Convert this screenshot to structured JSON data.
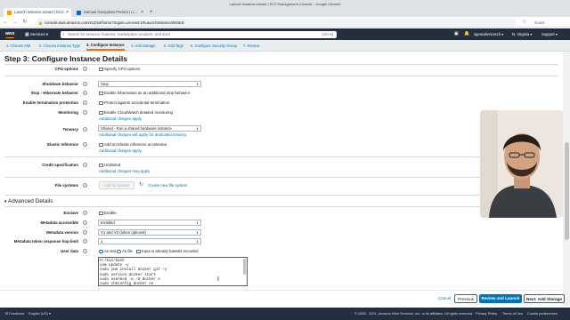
{
  "browser": {
    "window_title": "Launch instance wizard | EC2 Management Console - Google Chrome",
    "tabs": [
      {
        "label": "Launch instance wizard | EC2..."
      },
      {
        "label": "Samuel Gonçalves Pereira | Li..."
      }
    ],
    "new_tab": "+",
    "url": "console.aws.amazon.com/ec2/v2/home?region=us-east-1#LaunchInstanceWizard:",
    "profile": "Guest"
  },
  "aws_header": {
    "logo": "aws",
    "services_label": "Services",
    "search_placeholder": "Search for services, features, marketplace products, and docs",
    "search_shortcut": "[Alt+S]",
    "account": "sgoncalves.tech",
    "region": "N. Virginia",
    "support": "Support"
  },
  "wizard_steps": [
    {
      "label": "1. Choose AMI"
    },
    {
      "label": "2. Choose Instance Type"
    },
    {
      "label": "3. Configure Instance"
    },
    {
      "label": "4. Add Storage"
    },
    {
      "label": "5. Add Tags"
    },
    {
      "label": "6. Configure Security Group"
    },
    {
      "label": "7. Review"
    }
  ],
  "page_title": "Step 3: Configure Instance Details",
  "fields": {
    "cpu_options": {
      "label": "CPU options",
      "checkbox": "Specify CPU options"
    },
    "shutdown": {
      "label": "Shutdown behavior",
      "value": "Stop"
    },
    "hibernate": {
      "label": "Stop - Hibernate behavior",
      "checkbox": "Enable hibernation as an additional stop behavior"
    },
    "termination": {
      "label": "Enable termination protection",
      "checkbox": "Protect against accidental termination"
    },
    "monitoring": {
      "label": "Monitoring",
      "checkbox": "Enable CloudWatch detailed monitoring",
      "link": "Additional charges apply."
    },
    "tenancy": {
      "label": "Tenancy",
      "value": "Shared - Run a shared hardware instance",
      "link": "Additional charges will apply for dedicated tenancy."
    },
    "elastic_inference": {
      "label": "Elastic Inference",
      "checkbox": "Add an Elastic Inference accelerator",
      "link": "Additional charges apply."
    },
    "credit_spec": {
      "label": "Credit specification",
      "checkbox": "Unlimited",
      "link": "Additional charges may apply"
    },
    "file_systems": {
      "label": "File systems",
      "add_button": "Add file system",
      "create_link": "Create new file system"
    }
  },
  "advanced": {
    "section_title": "Advanced Details",
    "enclave": {
      "label": "Enclave",
      "checkbox": "Enable"
    },
    "metadata_accessible": {
      "label": "Metadata accessible",
      "value": "Enabled"
    },
    "metadata_version": {
      "label": "Metadata version",
      "value": "V1 and V2 (token optional)"
    },
    "hop_limit": {
      "label": "Metadata token response hop limit",
      "value": "1"
    },
    "user_data": {
      "label": "User data",
      "radio_text": "As text",
      "radio_file": "As file",
      "base64_checkbox": "Input is already base64 encoded",
      "lines": [
        "#!/bin/bash",
        "yum update -y",
        "sudo yum install docker git -y",
        "sudo service docker start",
        "sudo usermod -a -G docker e",
        "sudo chkconfig docker on"
      ]
    }
  },
  "actions": {
    "cancel": "Cancel",
    "previous": "Previous",
    "review_launch": "Review and Launch",
    "next": "Next: Add Storage"
  },
  "footer": {
    "feedback": "Feedback",
    "language": "English (US)",
    "copyright": "© 2008 - 2021, Amazon Web Services, Inc. or its affiliates. All rights reserved.",
    "privacy": "Privacy Policy",
    "terms": "Terms of Use",
    "cookies": "Cookie preferences"
  },
  "colors": {
    "aws_nav": "#232f3e",
    "aws_orange": "#ff9900",
    "link_blue": "#0073bb",
    "primary_button": "#0073bb",
    "step_active_underline": "#ec7211"
  }
}
